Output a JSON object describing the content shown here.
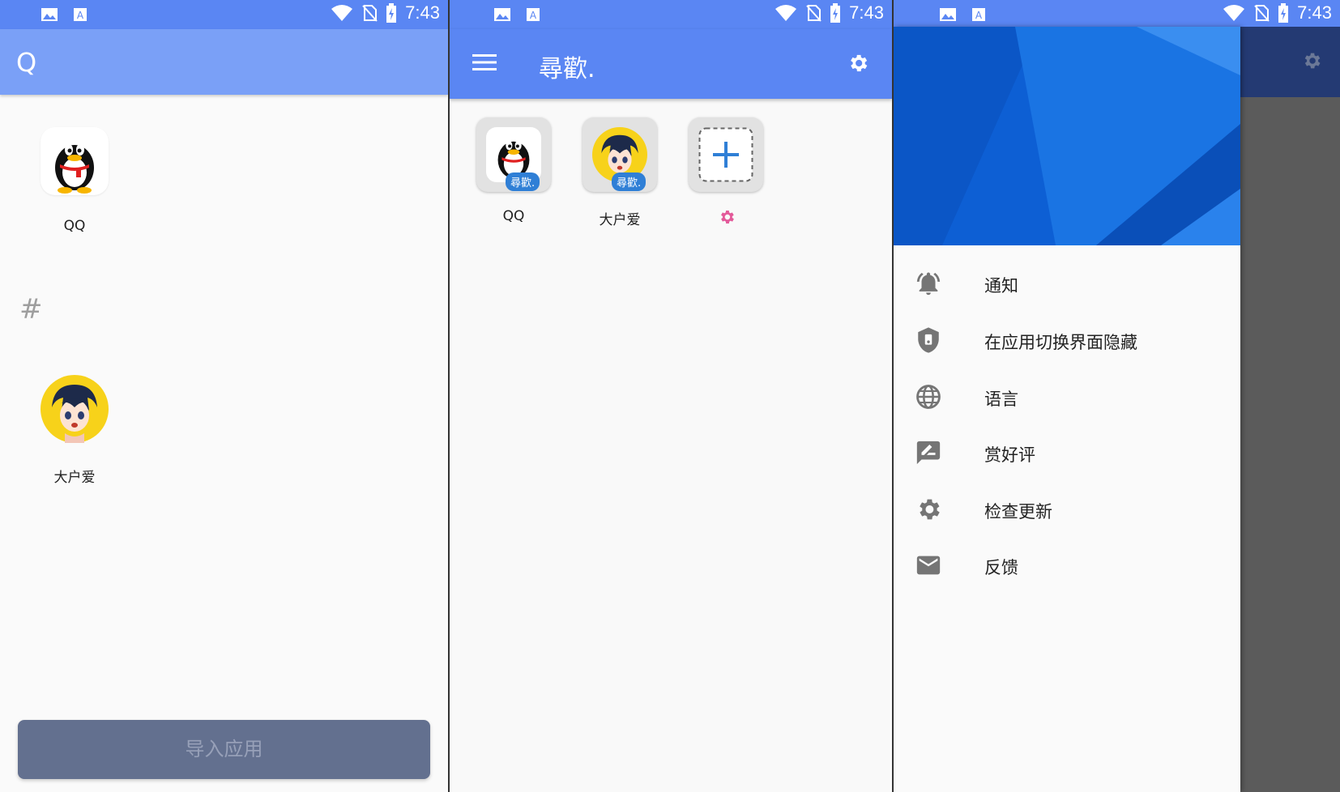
{
  "colors": {
    "primary": "#5a86f3",
    "header_light": "#7aa0f7",
    "import_button": "#63708f",
    "drawer_header": "#1565d8",
    "icon_grey": "#757575",
    "badge": "#2f7fd6",
    "pink_gear": "#e35a9a"
  },
  "status_bar": {
    "time": "7:43",
    "left_icons": [
      "image-icon",
      "text-a-icon"
    ],
    "right_icons": [
      "wifi-icon",
      "no-sim-icon",
      "battery-charging-icon"
    ]
  },
  "panel1": {
    "header_title": "Q",
    "apps": [
      {
        "label": "QQ",
        "icon": "qq-penguin-icon"
      },
      {
        "label": "大户爱",
        "icon": "anime-avatar-icon"
      }
    ],
    "section_header": "#",
    "import_button_label": "导入应用"
  },
  "panel2": {
    "title": "尋歡.",
    "menu_icon": "hamburger-menu-icon",
    "settings_icon": "gear-icon",
    "tiles": [
      {
        "label": "QQ",
        "badge": "尋歡.",
        "icon": "qq-penguin-icon"
      },
      {
        "label": "大户爱",
        "badge": "尋歡.",
        "icon": "anime-avatar-icon"
      },
      {
        "label": "",
        "icon": "add-icon",
        "label_icon": "pink-gear-icon"
      }
    ]
  },
  "panel3": {
    "menu_items": [
      {
        "label": "通知",
        "icon": "bell-ringing-icon"
      },
      {
        "label": "在应用切换界面隐藏",
        "icon": "shield-icon"
      },
      {
        "label": "语言",
        "icon": "globe-icon"
      },
      {
        "label": "赏好评",
        "icon": "rate-review-icon"
      },
      {
        "label": "检查更新",
        "icon": "gear-icon"
      },
      {
        "label": "反馈",
        "icon": "mail-icon"
      }
    ]
  }
}
